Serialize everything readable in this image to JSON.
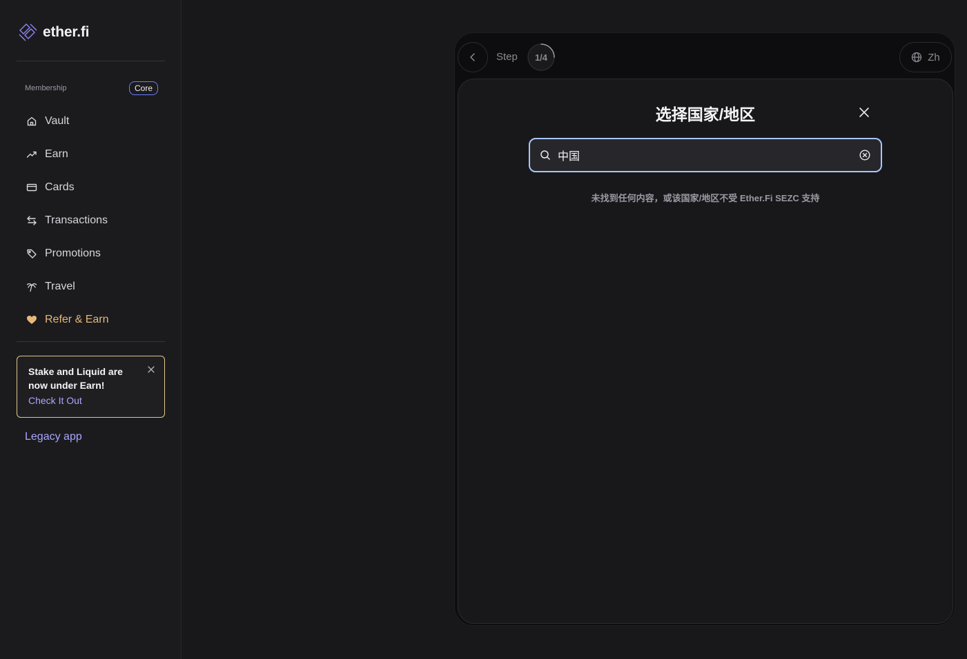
{
  "sidebar": {
    "logo_text": "ether.fi",
    "membership": {
      "label": "Membership",
      "tier": "Core"
    },
    "nav": [
      {
        "label": "Vault",
        "icon": "home-icon"
      },
      {
        "label": "Earn",
        "icon": "trending-up-icon"
      },
      {
        "label": "Cards",
        "icon": "card-icon"
      },
      {
        "label": "Transactions",
        "icon": "arrows-swap-icon"
      },
      {
        "label": "Promotions",
        "icon": "tag-icon"
      },
      {
        "label": "Travel",
        "icon": "palm-tree-icon"
      },
      {
        "label": "Refer & Earn",
        "icon": "heart-icon"
      }
    ],
    "promo": {
      "text": "Stake and Liquid are now under Earn!",
      "link": "Check It Out"
    },
    "legacy_link": "Legacy app"
  },
  "header": {
    "step_label": "Step",
    "step_value": "1/4",
    "step_progress": 0.25,
    "language": "Zh"
  },
  "modal": {
    "title": "选择国家/地区",
    "search": {
      "value": "中国",
      "placeholder": ""
    },
    "empty_message": "未找到任何内容，或该国家/地区不受 Ether.Fi SEZC 支持"
  },
  "colors": {
    "accent_link": "#a9a6ff",
    "promo_border": "#e2c788",
    "refer_color": "#e6b87a",
    "search_border": "#a8c8ff",
    "core_badge_border": "#6f7bff"
  }
}
